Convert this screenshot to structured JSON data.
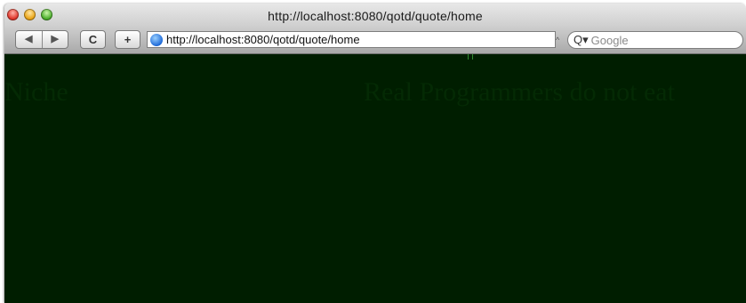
{
  "window": {
    "title": "http://localhost:8080/qotd/quote/home"
  },
  "toolbar": {
    "back_glyph": "◀",
    "forward_glyph": "▶",
    "reload_glyph": "C",
    "add_glyph": "+",
    "address_value": "http://localhost:8080/qotd/quote/home",
    "search_placeholder": "Google",
    "search_icon_glyph": "Q▾"
  },
  "page": {
    "left_text": "Niche",
    "right_text": "Real Programmers do not eat",
    "background_color": "#001e00",
    "text_color": "#042a04"
  },
  "colors": {
    "close": "#e0382c",
    "minimize": "#eaa518",
    "zoom": "#4cae2c"
  }
}
